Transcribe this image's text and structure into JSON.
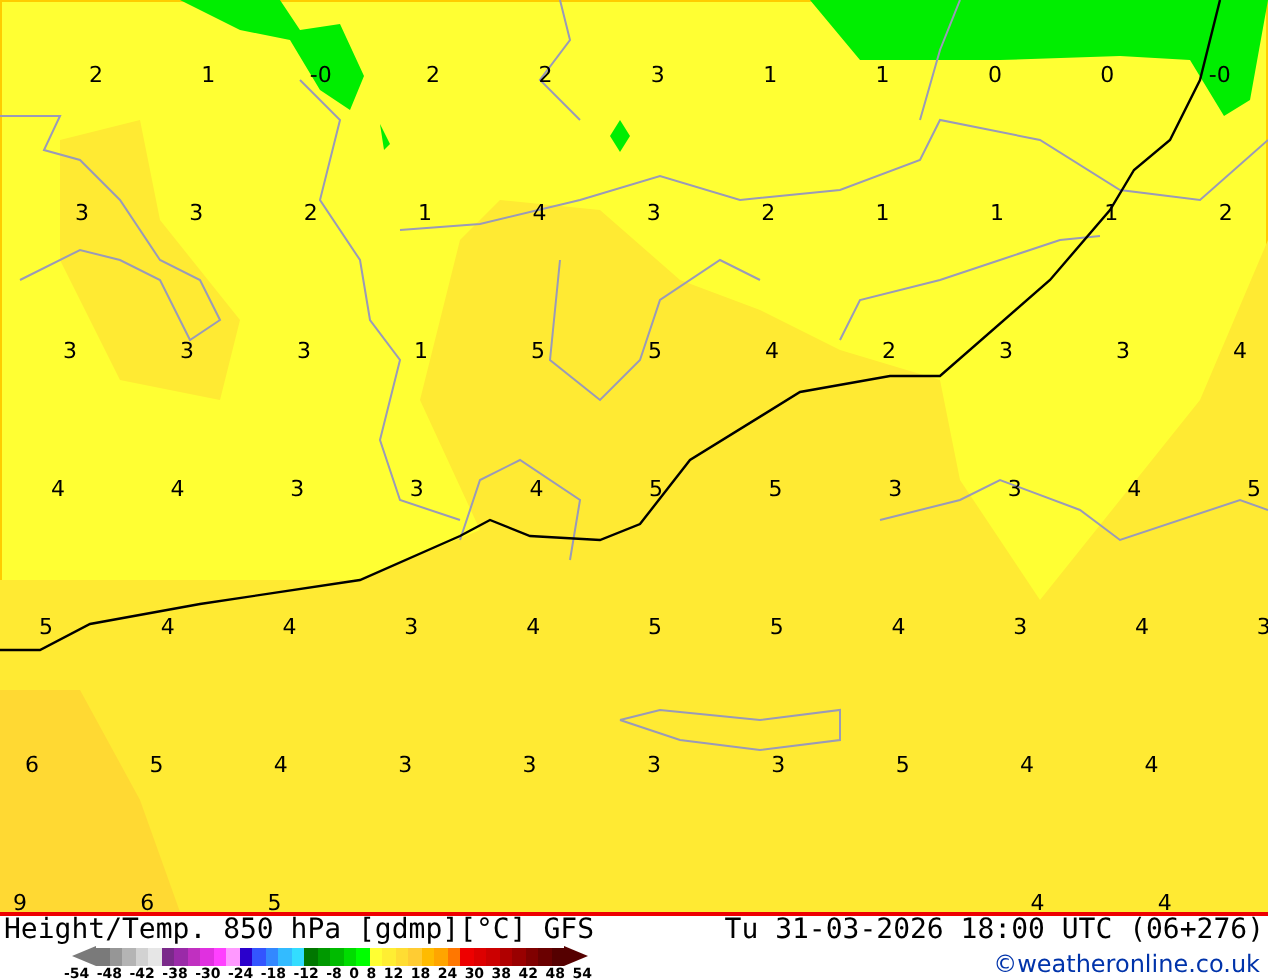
{
  "map": {
    "label_rows": [
      [
        "2",
        "1",
        "-0",
        "2",
        "2",
        "3",
        "1",
        "1",
        "0",
        "0",
        "-0"
      ],
      [
        "3",
        "3",
        "2",
        "1",
        "4",
        "3",
        "2",
        "1",
        "1",
        "1",
        "2"
      ],
      [
        "3",
        "3",
        "3",
        "1",
        "5",
        "5",
        "4",
        "2",
        "3",
        "3",
        "4"
      ],
      [
        "4",
        "4",
        "3",
        "3",
        "4",
        "5",
        "5",
        "3",
        "3",
        "4",
        "5"
      ],
      [
        "5",
        "4",
        "4",
        "3",
        "4",
        "5",
        "5",
        "4",
        "3",
        "4",
        "3"
      ],
      [
        "6",
        "5",
        "4",
        "3",
        "3",
        "3",
        "3",
        "5",
        "4",
        "4"
      ],
      [
        "9",
        "6",
        "5",
        null,
        null,
        null,
        null,
        null,
        "4",
        "4"
      ]
    ]
  },
  "footer": {
    "title": "Height/Temp. 850 hPa [gdmp][°C] GFS",
    "valid_time": "Tu 31-03-2026 18:00 UTC (06+276)",
    "credit": "©weatheronline.co.uk"
  },
  "legend": {
    "swatches": [
      {
        "color": "#7a7a7a"
      },
      {
        "color": "#969696"
      },
      {
        "color": "#b4b4b4"
      },
      {
        "color": "#d2d2d2"
      },
      {
        "color": "#e6e6e6"
      },
      {
        "color": "#7a2a8a"
      },
      {
        "color": "#9a2aa8"
      },
      {
        "color": "#c030c0"
      },
      {
        "color": "#e030e0"
      },
      {
        "color": "#ff40ff"
      },
      {
        "color": "#ff99ff"
      },
      {
        "color": "#2a00cc"
      },
      {
        "color": "#3355ff"
      },
      {
        "color": "#3388ff"
      },
      {
        "color": "#33bbff"
      },
      {
        "color": "#33ddff"
      },
      {
        "color": "#007700"
      },
      {
        "color": "#009900"
      },
      {
        "color": "#00bb00"
      },
      {
        "color": "#00dd00"
      },
      {
        "color": "#00ff00"
      },
      {
        "color": "#ffff33"
      },
      {
        "color": "#ffee33"
      },
      {
        "color": "#ffdd33"
      },
      {
        "color": "#ffcc33"
      },
      {
        "color": "#ffbb00"
      },
      {
        "color": "#ffa500"
      },
      {
        "color": "#ff7700"
      },
      {
        "color": "#ee0000"
      },
      {
        "color": "#dd0000"
      },
      {
        "color": "#cc0000"
      },
      {
        "color": "#b00000"
      },
      {
        "color": "#990000"
      },
      {
        "color": "#800000"
      },
      {
        "color": "#6a0000"
      },
      {
        "color": "#550000"
      }
    ],
    "ticks": [
      "-54",
      "-48",
      "-42",
      "-38",
      "-30",
      "-24",
      "-18",
      "-12",
      "-8",
      "0",
      "8",
      "12",
      "18",
      "24",
      "30",
      "38",
      "42",
      "48",
      "54"
    ]
  }
}
